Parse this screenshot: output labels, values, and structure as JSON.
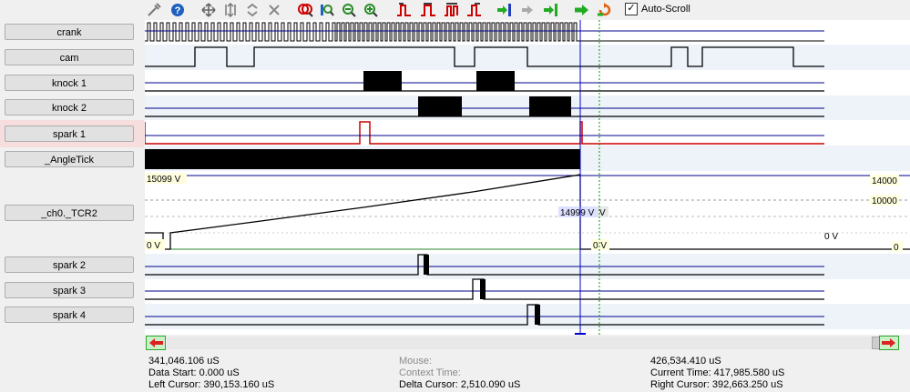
{
  "toolbar": {
    "icons": [
      "cursor-tool-icon",
      "help-icon",
      "pan-icon",
      "vertical-resize-icon",
      "collapse-icon",
      "expand-icon",
      "close-all-icon",
      "zoom-fit-icon",
      "zoom-range-icon",
      "zoom-out-icon",
      "zoom-in-icon",
      "edge-prev-icon",
      "edge-width-icon",
      "edge-cycle-icon",
      "edge-next-icon",
      "marker-left-icon",
      "goto-icon",
      "marker-right-icon",
      "run-icon",
      "reload-icon"
    ],
    "autoscroll_label": "Auto-Scroll",
    "autoscroll_checked": true
  },
  "channels": [
    {
      "label": "crank"
    },
    {
      "label": "cam"
    },
    {
      "label": "knock 1"
    },
    {
      "label": "knock 2"
    },
    {
      "label": "spark 1",
      "highlight": true
    },
    {
      "label": "_AngleTick"
    },
    {
      "label": "_ch0._TCR2"
    },
    {
      "label": "spark 2"
    },
    {
      "label": "spark 3"
    },
    {
      "label": "spark 4"
    }
  ],
  "analog": {
    "top_left": "15099 V",
    "bottom_left": "0 V",
    "cursor_value": "14999 V",
    "cursor_suffix": "V",
    "after_cursor_zero": "0 V",
    "right_zero_1": "0 V",
    "right_zero_2": "0",
    "scale_top": "14000",
    "scale_mid": "10000"
  },
  "status": {
    "start_time": "341,046.106 uS",
    "data_start": "Data Start:  0.000 uS",
    "left_cursor": "Left Cursor:  390,153.160 uS",
    "mouse": "Mouse:",
    "context_time": "Context Time:",
    "delta_cursor": "Delta Cursor:  2,510.090 uS",
    "end_time": "426,534.410 uS",
    "current_time": "Current Time:  417,985.580 uS",
    "right_cursor": "Right Cursor:  392,663.250 uS"
  },
  "colors": {
    "signal": "#000000",
    "spark1": "#cc0000",
    "cursor": "#0000cc",
    "cursor2": "#009900",
    "baseline": "#00008b",
    "band_light": "#eef3f9",
    "arrow_green": "#22aa22",
    "arrow_red": "#dd2222"
  }
}
